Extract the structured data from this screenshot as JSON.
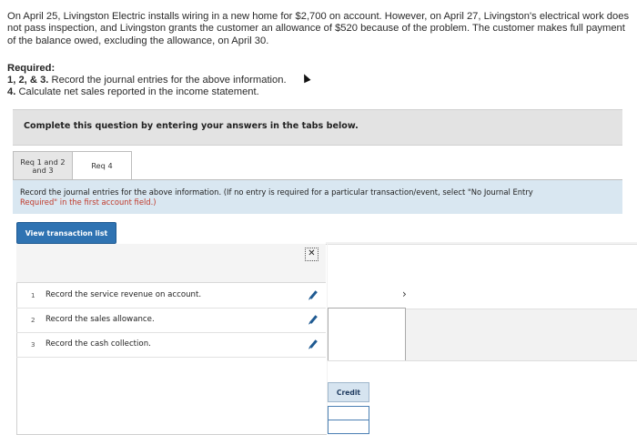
{
  "problem": {
    "text": "On April 25, Livingston Electric installs wiring in a new home for $2,700 on account. However, on April 27, Livingston's electrical work does not pass inspection, and Livingston grants the customer an allowance of $520 because of the problem. The customer makes full payment of the balance owed, excluding the allowance, on April 30."
  },
  "required": {
    "heading": "Required:",
    "items": [
      {
        "num": "1, 2, & 3.",
        "text": "Record the journal entries for the above information."
      },
      {
        "num": "4.",
        "text": "Calculate net sales reported in the income statement."
      }
    ]
  },
  "banner": "Complete this question by entering your answers in the tabs below.",
  "tabs": [
    {
      "label": "Req 1 and 2 and 3"
    },
    {
      "label": "Req 4"
    }
  ],
  "instructions": {
    "main": "Record the journal entries for the above information. (If no entry is required for a particular transaction/event, select \"No Journal Entry",
    "cont": "Required\" in the first account field.)"
  },
  "view_button": "View transaction list",
  "close_glyph": "✕",
  "transactions": [
    {
      "num": "1",
      "text": "Record the service revenue on account."
    },
    {
      "num": "2",
      "text": "Record the sales allowance."
    },
    {
      "num": "3",
      "text": "Record the cash collection."
    }
  ],
  "right_panel": {
    "chevron": "›",
    "credit_header": "Credit"
  }
}
